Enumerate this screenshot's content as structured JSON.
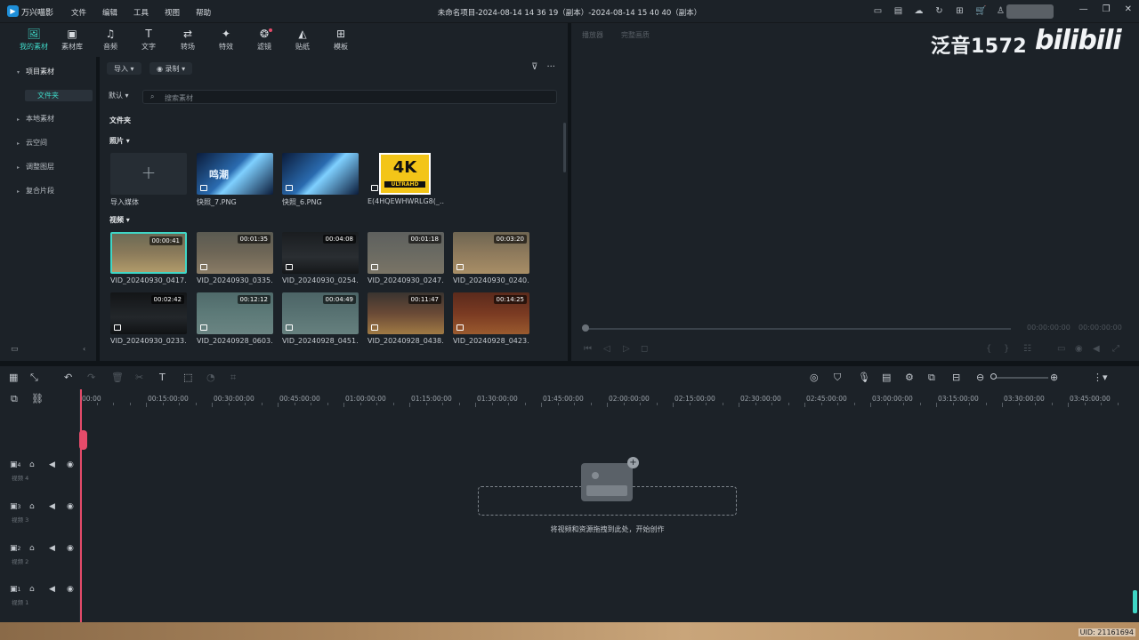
{
  "app": {
    "name": "万兴喵影",
    "window_title": "未命名项目-2024-08-14 14 36 19（副本）-2024-08-14 15 40 40（副本）"
  },
  "menu": [
    "文件",
    "编辑",
    "工具",
    "视图",
    "帮助"
  ],
  "toolbar": [
    {
      "label": "我的素材",
      "icon": "media-icon",
      "glyph": "🖼"
    },
    {
      "label": "素材库",
      "icon": "stock-icon",
      "glyph": "▣"
    },
    {
      "label": "音频",
      "icon": "music-icon",
      "glyph": "♫"
    },
    {
      "label": "文字",
      "icon": "text-icon",
      "glyph": "T"
    },
    {
      "label": "转场",
      "icon": "transition-icon",
      "glyph": "⇄"
    },
    {
      "label": "特效",
      "icon": "effects-icon",
      "glyph": "✦"
    },
    {
      "label": "滤镜",
      "icon": "filter-icon",
      "glyph": "❂"
    },
    {
      "label": "贴纸",
      "icon": "sticker-icon",
      "glyph": "◭"
    },
    {
      "label": "模板",
      "icon": "template-icon",
      "glyph": "⊞"
    }
  ],
  "sidebar": {
    "items": [
      {
        "label": "项目素材"
      },
      {
        "label": "本地素材"
      },
      {
        "label": "云空间"
      },
      {
        "label": "调整图层"
      },
      {
        "label": "复合片段"
      }
    ],
    "subfolder": "文件夹"
  },
  "media": {
    "import_label": "导入",
    "record_label": "录制",
    "sort_label": "默认",
    "search_placeholder": "搜索素材",
    "folder_heading": "文件夹",
    "photos_heading": "照片",
    "videos_heading": "视频",
    "photos": [
      {
        "name": "导入媒体"
      },
      {
        "name": "快照_7.PNG"
      },
      {
        "name": "快照_6.PNG"
      },
      {
        "name": "E(4HQEWHWRLG8(_..."
      }
    ],
    "badge_4k": "4K",
    "badge_uhd": "ULTRAHD",
    "photo_text": "鸣潮",
    "videos": [
      {
        "name": "VID_20240930_0417...",
        "duration": "00:00:41"
      },
      {
        "name": "VID_20240930_0335...",
        "duration": "00:01:35"
      },
      {
        "name": "VID_20240930_0254...",
        "duration": "00:04:08"
      },
      {
        "name": "VID_20240930_0247...",
        "duration": "00:01:18"
      },
      {
        "name": "VID_20240930_0240...",
        "duration": "00:03:20"
      },
      {
        "name": "VID_20240930_0233...",
        "duration": "00:02:42"
      },
      {
        "name": "VID_20240928_0603...",
        "duration": "00:12:12"
      },
      {
        "name": "VID_20240928_0451...",
        "duration": "00:04:49"
      },
      {
        "name": "VID_20240928_0438...",
        "duration": "00:11:47"
      },
      {
        "name": "VID_20240928_0423...",
        "duration": "00:14:25"
      }
    ]
  },
  "preview": {
    "tabs": [
      "播放器",
      "完整画质"
    ],
    "time_current": "00:00:00:00",
    "time_total": "00:00:00:00"
  },
  "watermark": {
    "text": "泛音1572",
    "logo": "bilibili"
  },
  "ruler": [
    "00:00",
    "00:15:00:00",
    "00:30:00:00",
    "00:45:00:00",
    "01:00:00:00",
    "01:15:00:00",
    "01:30:00:00",
    "01:45:00:00",
    "02:00:00:00",
    "02:15:00:00",
    "02:30:00:00",
    "02:45:00:00",
    "03:00:00:00",
    "03:15:00:00",
    "03:30:00:00",
    "03:45:00:00"
  ],
  "tracks": [
    {
      "num": "4",
      "name": "视频 4"
    },
    {
      "num": "3",
      "name": "视频 3"
    },
    {
      "num": "2",
      "name": "视频 2"
    },
    {
      "num": "1",
      "name": "视频 1"
    }
  ],
  "dropzone": {
    "text": "将视频和资源拖拽到此处，开始创作"
  },
  "uid": "UID: 21161694"
}
